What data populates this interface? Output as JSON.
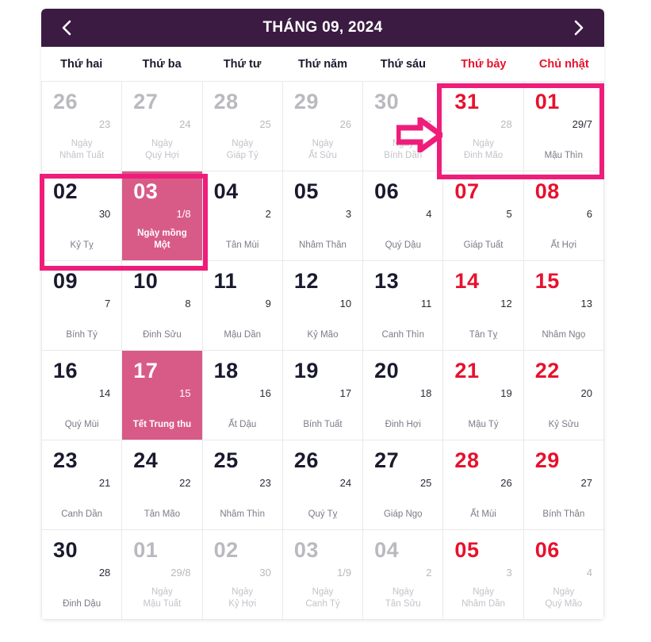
{
  "header": {
    "title": "THÁNG 09, 2024",
    "prev_label": "‹",
    "next_label": "›",
    "prev_name": "previous-month",
    "next_name": "next-month",
    "bar_color": "#3b1b42"
  },
  "colors": {
    "header_bg": "#3b1b42",
    "weekend_red": "#e8112d",
    "highlight_pink": "#ef1d7a",
    "filled_cell": "#d85b87",
    "muted_text": "#b9b9bf"
  },
  "weekdays": [
    {
      "label": "Thứ hai",
      "weekend": false
    },
    {
      "label": "Thứ ba",
      "weekend": false
    },
    {
      "label": "Thứ tư",
      "weekend": false
    },
    {
      "label": "Thứ năm",
      "weekend": false
    },
    {
      "label": "Thứ sáu",
      "weekend": false
    },
    {
      "label": "Thứ bảy",
      "weekend": true
    },
    {
      "label": "Chủ nhật",
      "weekend": true
    }
  ],
  "days": [
    {
      "solar": "26",
      "lunar": "23",
      "note": "Ngày\nNhâm Tuất",
      "muted": true,
      "weekend": false,
      "filled": false
    },
    {
      "solar": "27",
      "lunar": "24",
      "note": "Ngày\nQuý Hợi",
      "muted": true,
      "weekend": false,
      "filled": false
    },
    {
      "solar": "28",
      "lunar": "25",
      "note": "Ngày\nGiáp Tý",
      "muted": true,
      "weekend": false,
      "filled": false
    },
    {
      "solar": "29",
      "lunar": "26",
      "note": "Ngày\nẤt Sửu",
      "muted": true,
      "weekend": false,
      "filled": false
    },
    {
      "solar": "30",
      "lunar": "27",
      "note": "Ngày\nBính Dần",
      "muted": true,
      "weekend": false,
      "filled": false
    },
    {
      "solar": "31",
      "lunar": "28",
      "note": "Ngày\nĐinh Mão",
      "muted": true,
      "weekend": true,
      "filled": false
    },
    {
      "solar": "01",
      "lunar": "29/7",
      "note": "Mậu Thìn",
      "muted": false,
      "weekend": true,
      "filled": false
    },
    {
      "solar": "02",
      "lunar": "30",
      "note": "Kỷ Tỵ",
      "muted": false,
      "weekend": false,
      "filled": false
    },
    {
      "solar": "03",
      "lunar": "1/8",
      "note": "Ngày mồng\nMột",
      "muted": false,
      "weekend": false,
      "filled": true
    },
    {
      "solar": "04",
      "lunar": "2",
      "note": "Tân Mùi",
      "muted": false,
      "weekend": false,
      "filled": false
    },
    {
      "solar": "05",
      "lunar": "3",
      "note": "Nhâm Thân",
      "muted": false,
      "weekend": false,
      "filled": false
    },
    {
      "solar": "06",
      "lunar": "4",
      "note": "Quý Dậu",
      "muted": false,
      "weekend": false,
      "filled": false
    },
    {
      "solar": "07",
      "lunar": "5",
      "note": "Giáp Tuất",
      "muted": false,
      "weekend": true,
      "filled": false
    },
    {
      "solar": "08",
      "lunar": "6",
      "note": "Ất Hợi",
      "muted": false,
      "weekend": true,
      "filled": false
    },
    {
      "solar": "09",
      "lunar": "7",
      "note": "Bính Tý",
      "muted": false,
      "weekend": false,
      "filled": false
    },
    {
      "solar": "10",
      "lunar": "8",
      "note": "Đinh Sửu",
      "muted": false,
      "weekend": false,
      "filled": false
    },
    {
      "solar": "11",
      "lunar": "9",
      "note": "Mậu Dần",
      "muted": false,
      "weekend": false,
      "filled": false
    },
    {
      "solar": "12",
      "lunar": "10",
      "note": "Kỷ Mão",
      "muted": false,
      "weekend": false,
      "filled": false
    },
    {
      "solar": "13",
      "lunar": "11",
      "note": "Canh Thìn",
      "muted": false,
      "weekend": false,
      "filled": false
    },
    {
      "solar": "14",
      "lunar": "12",
      "note": "Tân Tỵ",
      "muted": false,
      "weekend": true,
      "filled": false
    },
    {
      "solar": "15",
      "lunar": "13",
      "note": "Nhâm Ngọ",
      "muted": false,
      "weekend": true,
      "filled": false
    },
    {
      "solar": "16",
      "lunar": "14",
      "note": "Quý Mùi",
      "muted": false,
      "weekend": false,
      "filled": false
    },
    {
      "solar": "17",
      "lunar": "15",
      "note": "Tết Trung thu",
      "muted": false,
      "weekend": false,
      "filled": true
    },
    {
      "solar": "18",
      "lunar": "16",
      "note": "Ất Dậu",
      "muted": false,
      "weekend": false,
      "filled": false
    },
    {
      "solar": "19",
      "lunar": "17",
      "note": "Bính Tuất",
      "muted": false,
      "weekend": false,
      "filled": false
    },
    {
      "solar": "20",
      "lunar": "18",
      "note": "Đinh Hợi",
      "muted": false,
      "weekend": false,
      "filled": false
    },
    {
      "solar": "21",
      "lunar": "19",
      "note": "Mậu Tý",
      "muted": false,
      "weekend": true,
      "filled": false
    },
    {
      "solar": "22",
      "lunar": "20",
      "note": "Kỷ Sửu",
      "muted": false,
      "weekend": true,
      "filled": false
    },
    {
      "solar": "23",
      "lunar": "21",
      "note": "Canh Dần",
      "muted": false,
      "weekend": false,
      "filled": false
    },
    {
      "solar": "24",
      "lunar": "22",
      "note": "Tân Mão",
      "muted": false,
      "weekend": false,
      "filled": false
    },
    {
      "solar": "25",
      "lunar": "23",
      "note": "Nhâm Thìn",
      "muted": false,
      "weekend": false,
      "filled": false
    },
    {
      "solar": "26",
      "lunar": "24",
      "note": "Quý Tỵ",
      "muted": false,
      "weekend": false,
      "filled": false
    },
    {
      "solar": "27",
      "lunar": "25",
      "note": "Giáp Ngọ",
      "muted": false,
      "weekend": false,
      "filled": false
    },
    {
      "solar": "28",
      "lunar": "26",
      "note": "Ất Mùi",
      "muted": false,
      "weekend": true,
      "filled": false
    },
    {
      "solar": "29",
      "lunar": "27",
      "note": "Bính Thân",
      "muted": false,
      "weekend": true,
      "filled": false
    },
    {
      "solar": "30",
      "lunar": "28",
      "note": "Đinh Dậu",
      "muted": false,
      "weekend": false,
      "filled": false
    },
    {
      "solar": "01",
      "lunar": "29/8",
      "note": "Ngày\nMậu Tuất",
      "muted": true,
      "weekend": false,
      "filled": false
    },
    {
      "solar": "02",
      "lunar": "30",
      "note": "Ngày\nKỷ Hợi",
      "muted": true,
      "weekend": false,
      "filled": false
    },
    {
      "solar": "03",
      "lunar": "1/9",
      "note": "Ngày\nCanh Tý",
      "muted": true,
      "weekend": false,
      "filled": false
    },
    {
      "solar": "04",
      "lunar": "2",
      "note": "Ngày\nTân Sửu",
      "muted": true,
      "weekend": false,
      "filled": false
    },
    {
      "solar": "05",
      "lunar": "3",
      "note": "Ngày\nNhâm Dần",
      "muted": true,
      "weekend": true,
      "filled": false
    },
    {
      "solar": "06",
      "lunar": "4",
      "note": "Ngày\nQuý Mão",
      "muted": true,
      "weekend": true,
      "filled": false
    }
  ],
  "annotations": {
    "arrow": {
      "name": "pointer-arrow",
      "direction": "right",
      "color": "#ef1d7a"
    },
    "boxes": [
      {
        "name": "highlight-box-aug31-sep01",
        "color": "#ef1d7a"
      },
      {
        "name": "highlight-box-sep02-sep03",
        "color": "#ef1d7a"
      }
    ]
  }
}
